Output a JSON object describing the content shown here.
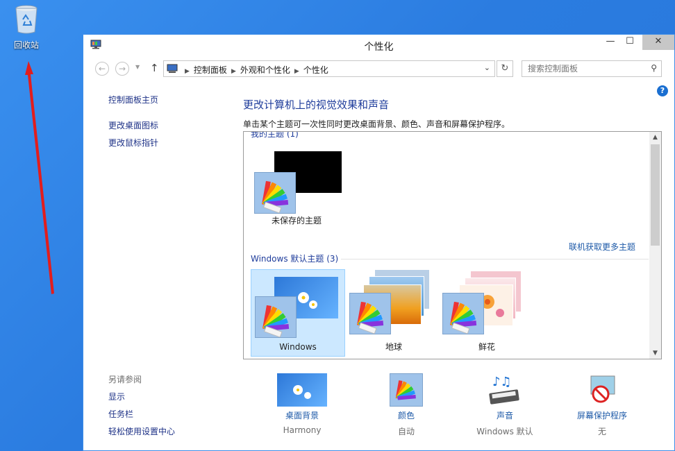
{
  "desktop": {
    "recycle_bin_label": "回收站"
  },
  "window": {
    "title": "个性化"
  },
  "nav": {
    "breadcrumbs": [
      "控制面板",
      "外观和个性化",
      "个性化"
    ],
    "search_placeholder": "搜索控制面板"
  },
  "sidebar": {
    "home": "控制面板主页",
    "links": [
      "更改桌面图标",
      "更改鼠标指针"
    ],
    "see_also_header": "另请参阅",
    "see_also": [
      "显示",
      "任务栏",
      "轻松使用设置中心"
    ]
  },
  "main": {
    "title": "更改计算机上的视觉效果和声音",
    "description": "单击某个主题可一次性同时更改桌面背景、颜色、声音和屏幕保护程序。"
  },
  "themes": {
    "my_group": "我的主题 (1)",
    "my_items": [
      {
        "name": "未保存的主题"
      }
    ],
    "online_link": "联机获取更多主题",
    "default_group": "Windows 默认主题 (3)",
    "default_items": [
      {
        "name": "Windows",
        "selected": true
      },
      {
        "name": "地球",
        "selected": false
      },
      {
        "name": "鲜花",
        "selected": false
      }
    ]
  },
  "bottom": [
    {
      "label": "桌面背景",
      "value": "Harmony",
      "icon": "desktop-background-icon"
    },
    {
      "label": "颜色",
      "value": "自动",
      "icon": "color-palette-icon"
    },
    {
      "label": "声音",
      "value": "Windows 默认",
      "icon": "sound-icon"
    },
    {
      "label": "屏幕保护程序",
      "value": "无",
      "icon": "screensaver-icon"
    }
  ],
  "colors": {
    "accent": "#1e3c9b",
    "link": "#1e5aa8",
    "selection": "#cce8ff",
    "desktop": "#2b7ce0"
  }
}
